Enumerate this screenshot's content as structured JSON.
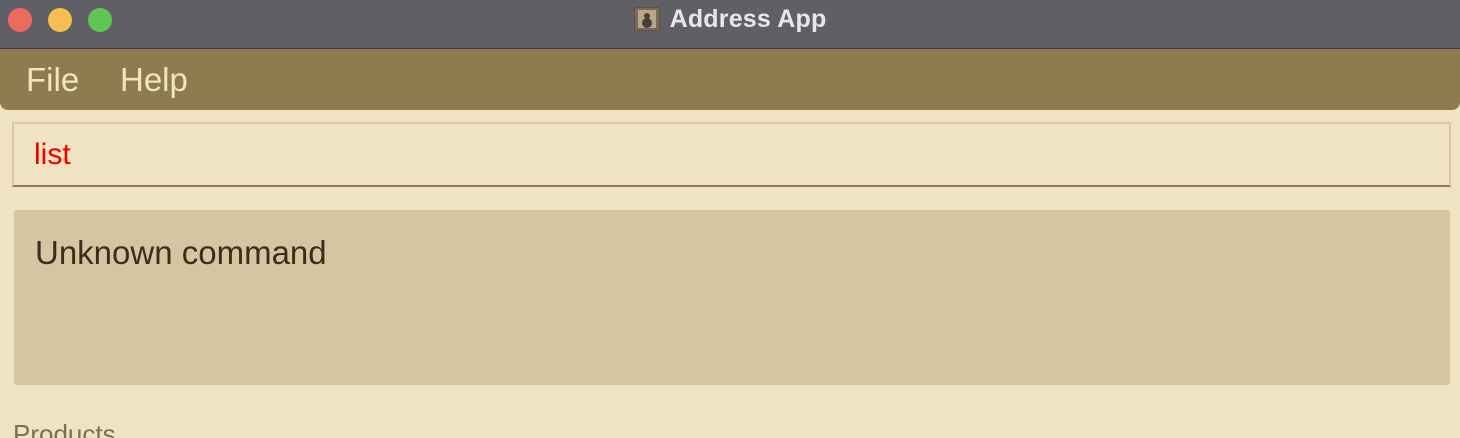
{
  "window": {
    "title": "Address App",
    "app_icon": "contacts-book-icon",
    "controls": [
      "close",
      "minimize",
      "zoom"
    ]
  },
  "menu": {
    "items": [
      {
        "label": "File"
      },
      {
        "label": "Help"
      }
    ]
  },
  "command_box": {
    "value": "list",
    "text_color": "#ee0000"
  },
  "result_display": {
    "message": "Unknown command"
  },
  "products_section": {
    "label": "Products"
  },
  "colors": {
    "titlebar": "#615f66",
    "menubar": "#8e7b50",
    "background": "#efe3c1",
    "result_background": "#d4c6a0",
    "close": "#ee6a5f",
    "minimize": "#f5bf4f",
    "zoom": "#61c554"
  }
}
